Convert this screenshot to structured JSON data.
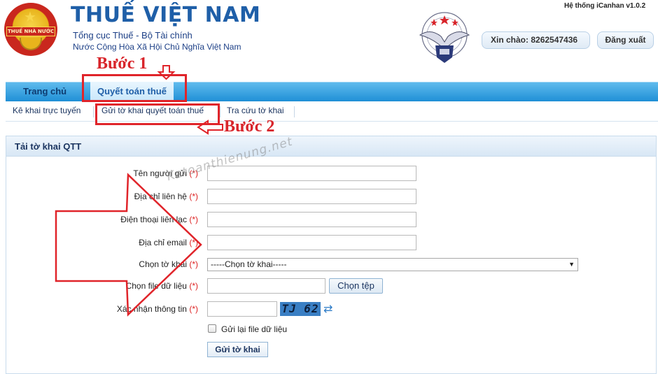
{
  "header": {
    "logo_band_text": "THUẾ NHÀ NƯỚC",
    "title": "THUẾ VIỆT NAM",
    "subtitle_1": "Tổng cục Thuế - Bộ Tài chính",
    "subtitle_2": "Nước Cộng Hòa Xã Hội Chủ Nghĩa Việt Nam",
    "system_version": "Hệ thống iCanhan v1.0.2",
    "greeting": "Xin chào: 8262547436",
    "logout_label": "Đăng xuất"
  },
  "nav": {
    "tabs": [
      {
        "label": "Trang chủ"
      },
      {
        "label": "Quyết toán thuế"
      }
    ],
    "active_tab": "Quyết toán thuế",
    "sub_items": [
      {
        "label": "Kê khai trực tuyến"
      },
      {
        "label": "Gửi tờ khai quyết toán thuế"
      },
      {
        "label": "Tra cứu tờ khai"
      }
    ]
  },
  "form": {
    "panel_title": "Tải tờ khai QTT",
    "required_mark": "(*)",
    "fields": [
      {
        "label": "Tên người gửi",
        "value": ""
      },
      {
        "label": "Địa chỉ liên hệ",
        "value": ""
      },
      {
        "label": "Điện thoại liên lạc",
        "value": ""
      },
      {
        "label": "Địa chỉ email",
        "value": ""
      }
    ],
    "declaration_label": "Chọn tờ khai",
    "declaration_selected": "-----Chọn tờ khai-----",
    "file_label": "Chọn file dữ liệu",
    "choose_file_button": "Chọn tệp",
    "captcha_label": "Xác nhận thông tin",
    "captcha_text": "TJ 62",
    "resend_label": "Gửi lại file dữ liệu",
    "resend_checked": false,
    "submit_label": "Gửi tờ khai"
  },
  "annotations": {
    "step_1": "Bước 1",
    "step_2": "Bước 2",
    "watermark": "Ketoanthienung.net"
  },
  "colors": {
    "brand_blue": "#1f5fa8",
    "nav_blue": "#1f8fd6",
    "annotation_red": "#e0242a"
  }
}
